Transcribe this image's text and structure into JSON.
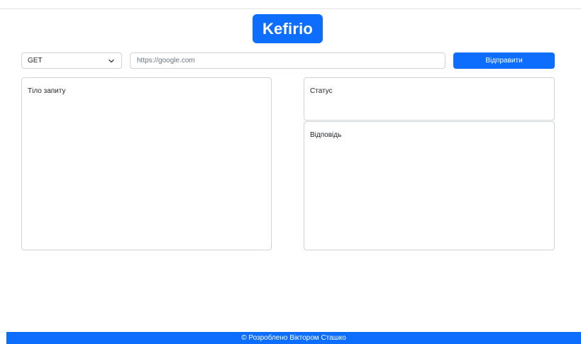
{
  "header": {
    "logo_text": "Kefirio"
  },
  "request": {
    "method": {
      "selected": "GET",
      "icon": "chevron-down-icon"
    },
    "url": {
      "value": "",
      "placeholder": "https://google.com"
    },
    "send_label": "Відправити",
    "body": {
      "value": "",
      "placeholder": "Тіло запиту"
    }
  },
  "response": {
    "status": {
      "value": "",
      "placeholder": "Статус"
    },
    "body": {
      "value": "",
      "placeholder": "Відповідь"
    }
  },
  "footer": {
    "text": "© Розроблено Віктором Сташко"
  },
  "colors": {
    "accent": "#0d6efd",
    "border": "#ced4da",
    "background": "#ffffff"
  }
}
